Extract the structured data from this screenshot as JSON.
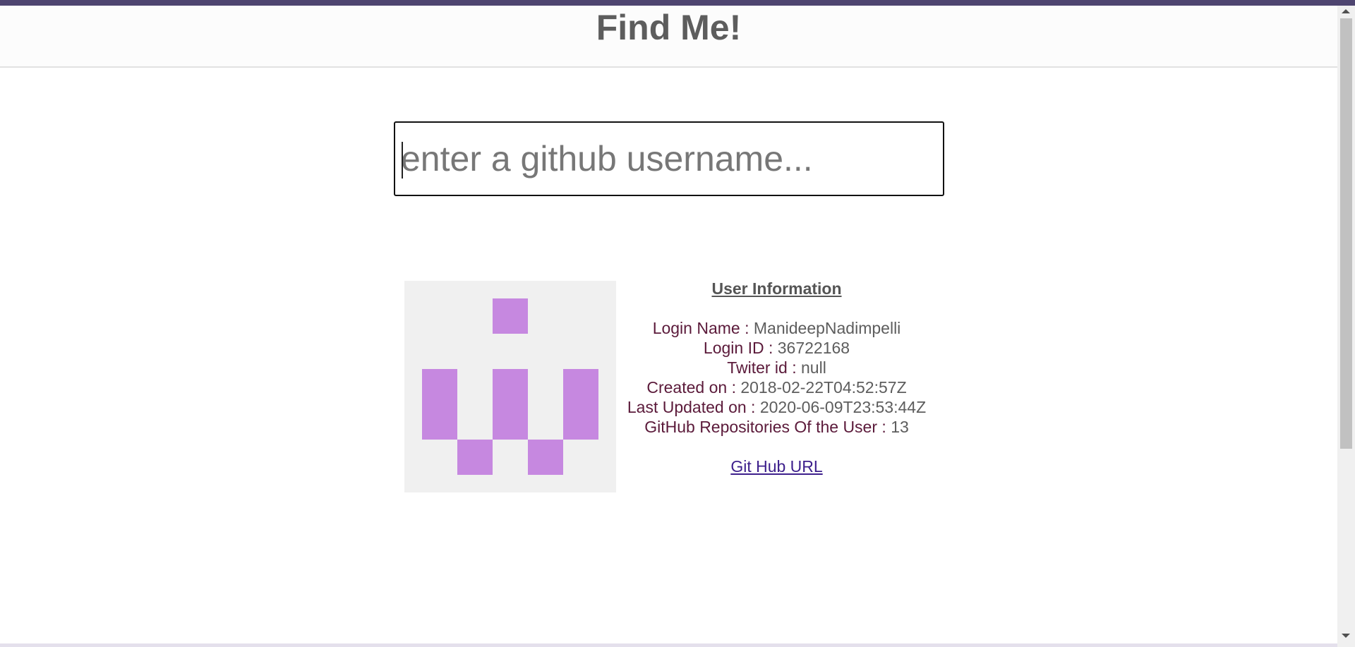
{
  "header": {
    "title": "Find Me!"
  },
  "search": {
    "placeholder": "enter a github username...",
    "value": ""
  },
  "user": {
    "section_title": "User Information",
    "fields": [
      {
        "label": "Login Name : ",
        "value": "ManideepNadimpelli"
      },
      {
        "label": "Login ID : ",
        "value": "36722168"
      },
      {
        "label": "Twiter id : ",
        "value": "null"
      },
      {
        "label": "Created on : ",
        "value": "2018-02-22T04:52:57Z"
      },
      {
        "label": "Last Updated on : ",
        "value": "2020-06-09T23:53:44Z"
      },
      {
        "label": "GitHub Repositories Of the User : ",
        "value": "13"
      }
    ],
    "link_label": "Git Hub URL"
  },
  "colors": {
    "accent_bar": "#4e4570",
    "avatar_bg": "#f0f0f0",
    "avatar_fg": "#c688e0",
    "label_text": "#5b1a3a",
    "value_text": "#5d5d5d",
    "link": "#3d1f8c"
  }
}
